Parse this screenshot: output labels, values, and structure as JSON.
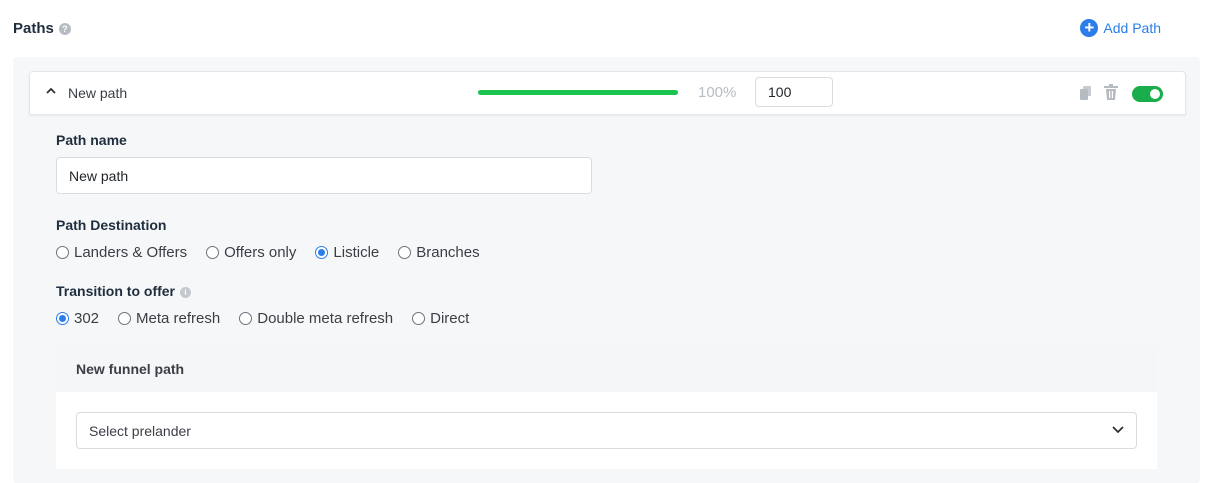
{
  "header": {
    "title": "Paths",
    "help_icon": "question-circle-icon",
    "add_path_label": "Add Path",
    "add_icon": "plus-circle-icon"
  },
  "path": {
    "title": "New path",
    "collapse_icon": "chevron-up-icon",
    "progress": 1.0,
    "progress_label": "100%",
    "weight_value": "100",
    "actions": {
      "copy_icon": "copy-icon",
      "delete_icon": "trash-icon",
      "enabled": true
    },
    "name_label": "Path name",
    "name_value": "New path",
    "destination_label": "Path Destination",
    "destination_options": [
      "Landers & Offers",
      "Offers only",
      "Listicle",
      "Branches"
    ],
    "destination_selected": "Listicle",
    "transition_label": "Transition to offer",
    "transition_info_icon": "info-icon",
    "transition_options": [
      "302",
      "Meta refresh",
      "Double meta refresh",
      "Direct"
    ],
    "transition_selected": "302",
    "funnel": {
      "title": "New funnel path",
      "select_placeholder": "Select prelander",
      "select_icon": "chevron-down-icon"
    }
  },
  "colors": {
    "accent": "#2b7de9",
    "progress": "#1ac44f",
    "toggle_on": "#1aad4b"
  }
}
